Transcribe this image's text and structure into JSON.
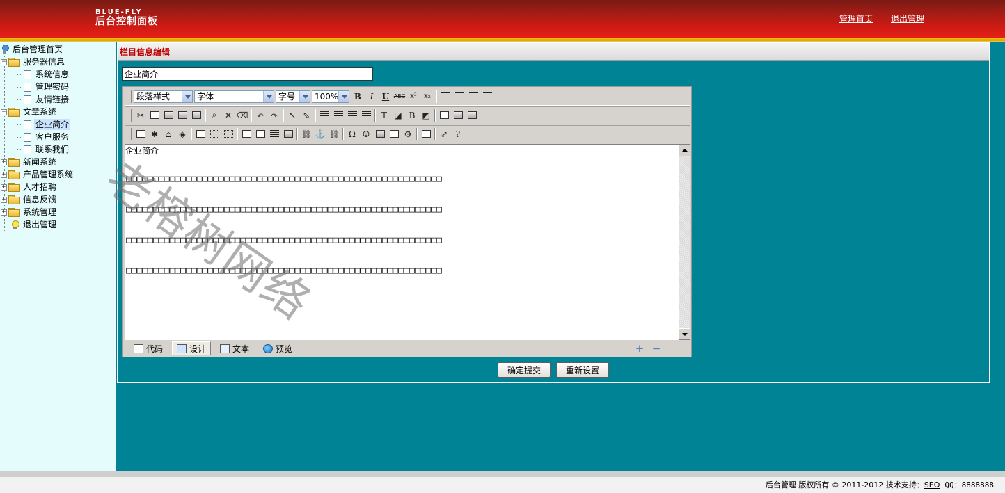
{
  "header": {
    "brand_en": "BLUE-FLY",
    "brand_cn": "后台控制面板",
    "links": [
      "管理首页",
      "退出管理"
    ]
  },
  "sidebar": {
    "home": "后台管理首页",
    "groups": [
      {
        "label": "服务器信息",
        "expanded": true,
        "children": [
          "系统信息",
          "管理密码",
          "友情链接"
        ]
      },
      {
        "label": "文章系统",
        "expanded": true,
        "children": [
          "企业简介",
          "客户服务",
          "联系我们"
        ],
        "active_child": "企业简介"
      },
      {
        "label": "新闻系统",
        "expanded": false
      },
      {
        "label": "产品管理系统",
        "expanded": false
      },
      {
        "label": "人才招聘",
        "expanded": false
      },
      {
        "label": "信息反馈",
        "expanded": false
      },
      {
        "label": "系统管理",
        "expanded": false
      }
    ],
    "logout": "退出管理"
  },
  "panel": {
    "title": "栏目信息编辑",
    "title_input_value": "企业简介"
  },
  "editor": {
    "toolbar": {
      "paragraph_style": "段落样式",
      "font": "字体",
      "font_size": "字号",
      "zoom": "100%",
      "bold": "B",
      "italic": "I",
      "underline": "U",
      "strike": "ABC",
      "superscript": "x²",
      "subscript": "x₂"
    },
    "content_first_line": "企业简介",
    "content_lines": [
      "□□□□□□□□□□□□□□□□□□□□□□□□□□□□□□□□□□□□□□□□□□□□□□□□□□□□□□□□□□",
      "□□□□□□□□□□□□□□□□□□□□□□□□□□□□□□□□□□□□□□□□□□□□□□□□□□□□□□□□□□",
      "□□□□□□□□□□□□□□□□□□□□□□□□□□□□□□□□□□□□□□□□□□□□□□□□□□□□□□□□□□",
      "□□□□□□□□□□□□□□□□□□□□□□□□□□□□□□□□□□□□□□□□□□□□□□□□□□□□□□□□□□"
    ],
    "modes": [
      "代码",
      "设计",
      "文本",
      "预览"
    ],
    "active_mode": "设计",
    "zoom_in": "+",
    "zoom_out": "−"
  },
  "buttons": {
    "submit": "确定提交",
    "reset": "重新设置"
  },
  "watermark": "老榕树网络",
  "footer": {
    "text": "后台管理  版权所有 © 2011-2012  技术支持：",
    "seo": "SEO",
    "qq": "QQ：8888888"
  },
  "colors": {
    "header_red": "#d01a14",
    "main_teal": "#008395",
    "sidebar_bg": "#e4fcfc",
    "panel_title_red": "#c00000"
  }
}
